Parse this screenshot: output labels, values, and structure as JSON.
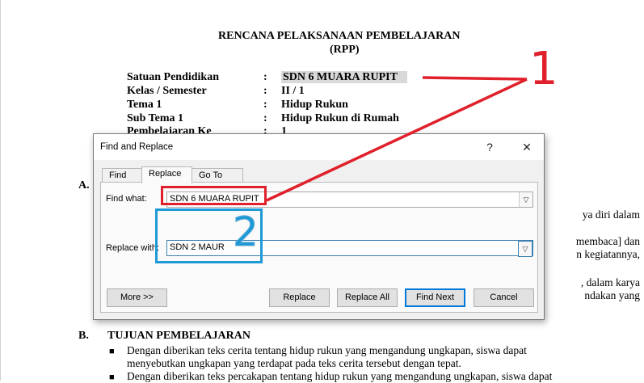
{
  "document": {
    "title": "RENCANA PELAKSANAAN PEMBELAJARAN",
    "subtitle": "(RPP)",
    "info_rows": [
      {
        "label": "Satuan Pendidikan",
        "colon": ":",
        "value": "SDN 6 MUARA RUPIT"
      },
      {
        "label": "Kelas / Semester",
        "colon": ":",
        "value": "II / 1"
      },
      {
        "label": "Tema 1",
        "colon": ":",
        "value": "Hidup Rukun"
      },
      {
        "label": "Sub Tema 1",
        "colon": ":",
        "value": "Hidup Rukun di Rumah"
      },
      {
        "label": "Pembelajaran Ke",
        "colon": ":",
        "value": "1"
      }
    ],
    "section_a": "A.",
    "right_fragments": [
      "ya diri dalam",
      "membaca] dan",
      "n kegiatannya,",
      ", dalam karya",
      "ndakan yang"
    ],
    "section_b_letter": "B.",
    "section_b_title": "TUJUAN PEMBELAJARAN",
    "bullets": [
      {
        "line1": "Dengan diberikan teks cerita tentang hidup rukun yang mengandung ungkapan, siswa dapat",
        "line2": "menyebutkan ungkapan yang terdapat pada teks cerita tersebut dengan tepat."
      },
      {
        "line1": "Dengan diberikan teks percakapan tentang hidup rukun yang mengandung ungkapan, siswa dapat",
        "line2": ""
      }
    ]
  },
  "dialog": {
    "title": "Find and Replace",
    "help": "?",
    "close": "✕",
    "tabs": [
      "Find",
      "Replace",
      "Go To"
    ],
    "find_label": "Find what:",
    "find_value": "SDN 6 MUARA RUPIT",
    "replace_label": "Replace with:",
    "replace_value": "SDN 2 MAUR",
    "buttons": {
      "more": "More >>",
      "replace": "Replace",
      "replace_all": "Replace All",
      "find_next": "Find Next",
      "cancel": "Cancel"
    }
  },
  "annotations": {
    "step1": "1",
    "step2": "2",
    "red": "#e0202a",
    "blue": "#1e9ad6"
  }
}
